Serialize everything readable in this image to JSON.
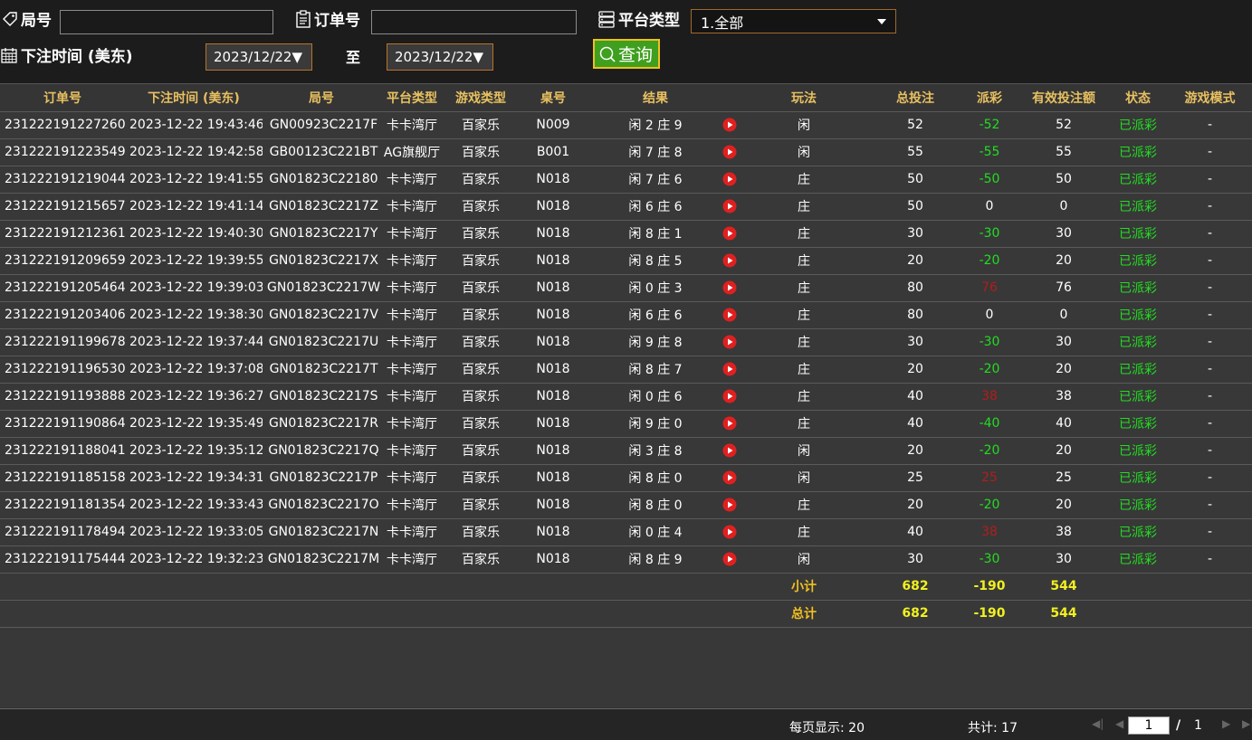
{
  "filters": {
    "round_label": "局号",
    "round_value": "",
    "order_label": "订单号",
    "order_value": "",
    "platform_label": "平台类型",
    "platform_selected": "1.全部",
    "time_label": "下注时间 (美东)",
    "date_from": "2023/12/22",
    "to_label": "至",
    "date_to": "2023/12/22",
    "query_label": "查询"
  },
  "columns": [
    "订单号",
    "下注时间 (美东)",
    "局号",
    "平台类型",
    "游戏类型",
    "桌号",
    "结果",
    "",
    "玩法",
    "总投注",
    "派彩",
    "有效投注额",
    "状态",
    "游戏模式"
  ],
  "rows": [
    [
      "231222191227260",
      "2023-12-22 19:43:46",
      "GN00923C2217F",
      "卡卡湾厅",
      "百家乐",
      "N009",
      "闲 2 庄 9",
      "闲",
      "52",
      "-52",
      "52",
      "已派彩",
      "-",
      "green"
    ],
    [
      "231222191223549",
      "2023-12-22 19:42:58",
      "GB00123C221BT",
      "AG旗舰厅",
      "百家乐",
      "B001",
      "闲 7 庄 8",
      "闲",
      "55",
      "-55",
      "55",
      "已派彩",
      "-",
      "green"
    ],
    [
      "231222191219044",
      "2023-12-22 19:41:55",
      "GN01823C22180",
      "卡卡湾厅",
      "百家乐",
      "N018",
      "闲 7 庄 6",
      "庄",
      "50",
      "-50",
      "50",
      "已派彩",
      "-",
      "green"
    ],
    [
      "231222191215657",
      "2023-12-22 19:41:14",
      "GN01823C2217Z",
      "卡卡湾厅",
      "百家乐",
      "N018",
      "闲 6 庄 6",
      "庄",
      "50",
      "0",
      "0",
      "已派彩",
      "-",
      "white"
    ],
    [
      "231222191212361",
      "2023-12-22 19:40:30",
      "GN01823C2217Y",
      "卡卡湾厅",
      "百家乐",
      "N018",
      "闲 8 庄 1",
      "庄",
      "30",
      "-30",
      "30",
      "已派彩",
      "-",
      "green"
    ],
    [
      "231222191209659",
      "2023-12-22 19:39:55",
      "GN01823C2217X",
      "卡卡湾厅",
      "百家乐",
      "N018",
      "闲 8 庄 5",
      "庄",
      "20",
      "-20",
      "20",
      "已派彩",
      "-",
      "green"
    ],
    [
      "231222191205464",
      "2023-12-22 19:39:03",
      "GN01823C2217W",
      "卡卡湾厅",
      "百家乐",
      "N018",
      "闲 0 庄 3",
      "庄",
      "80",
      "76",
      "76",
      "已派彩",
      "-",
      "red"
    ],
    [
      "231222191203406",
      "2023-12-22 19:38:30",
      "GN01823C2217V",
      "卡卡湾厅",
      "百家乐",
      "N018",
      "闲 6 庄 6",
      "庄",
      "80",
      "0",
      "0",
      "已派彩",
      "-",
      "white"
    ],
    [
      "231222191199678",
      "2023-12-22 19:37:44",
      "GN01823C2217U",
      "卡卡湾厅",
      "百家乐",
      "N018",
      "闲 9 庄 8",
      "庄",
      "30",
      "-30",
      "30",
      "已派彩",
      "-",
      "green"
    ],
    [
      "231222191196530",
      "2023-12-22 19:37:08",
      "GN01823C2217T",
      "卡卡湾厅",
      "百家乐",
      "N018",
      "闲 8 庄 7",
      "庄",
      "20",
      "-20",
      "20",
      "已派彩",
      "-",
      "green"
    ],
    [
      "231222191193888",
      "2023-12-22 19:36:27",
      "GN01823C2217S",
      "卡卡湾厅",
      "百家乐",
      "N018",
      "闲 0 庄 6",
      "庄",
      "40",
      "38",
      "38",
      "已派彩",
      "-",
      "red"
    ],
    [
      "231222191190864",
      "2023-12-22 19:35:49",
      "GN01823C2217R",
      "卡卡湾厅",
      "百家乐",
      "N018",
      "闲 9 庄 0",
      "庄",
      "40",
      "-40",
      "40",
      "已派彩",
      "-",
      "green"
    ],
    [
      "231222191188041",
      "2023-12-22 19:35:12",
      "GN01823C2217Q",
      "卡卡湾厅",
      "百家乐",
      "N018",
      "闲 3 庄 8",
      "闲",
      "20",
      "-20",
      "20",
      "已派彩",
      "-",
      "green"
    ],
    [
      "231222191185158",
      "2023-12-22 19:34:31",
      "GN01823C2217P",
      "卡卡湾厅",
      "百家乐",
      "N018",
      "闲 8 庄 0",
      "闲",
      "25",
      "25",
      "25",
      "已派彩",
      "-",
      "red"
    ],
    [
      "231222191181354",
      "2023-12-22 19:33:43",
      "GN01823C2217O",
      "卡卡湾厅",
      "百家乐",
      "N018",
      "闲 8 庄 0",
      "庄",
      "20",
      "-20",
      "20",
      "已派彩",
      "-",
      "green"
    ],
    [
      "231222191178494",
      "2023-12-22 19:33:05",
      "GN01823C2217N",
      "卡卡湾厅",
      "百家乐",
      "N018",
      "闲 0 庄 4",
      "庄",
      "40",
      "38",
      "38",
      "已派彩",
      "-",
      "red"
    ],
    [
      "231222191175444",
      "2023-12-22 19:32:23",
      "GN01823C2217M",
      "卡卡湾厅",
      "百家乐",
      "N018",
      "闲 8 庄 9",
      "闲",
      "30",
      "-30",
      "30",
      "已派彩",
      "-",
      "green"
    ]
  ],
  "subtotal": {
    "label": "小计",
    "total_bet": "682",
    "payout": "-190",
    "valid_bet": "544"
  },
  "grandtotal": {
    "label": "总计",
    "total_bet": "682",
    "payout": "-190",
    "valid_bet": "544"
  },
  "footer": {
    "per_page": "每页显示: 20",
    "total": "共计: 17",
    "current_page": "1",
    "separator": "/",
    "total_pages": "1"
  },
  "colors": {
    "header_text": "#e8c060",
    "win": "#22dd22",
    "loss": "#b21d1d",
    "summary": "#f0f020",
    "play_icon": "#e02020",
    "query_button": "#3f9f1f"
  }
}
